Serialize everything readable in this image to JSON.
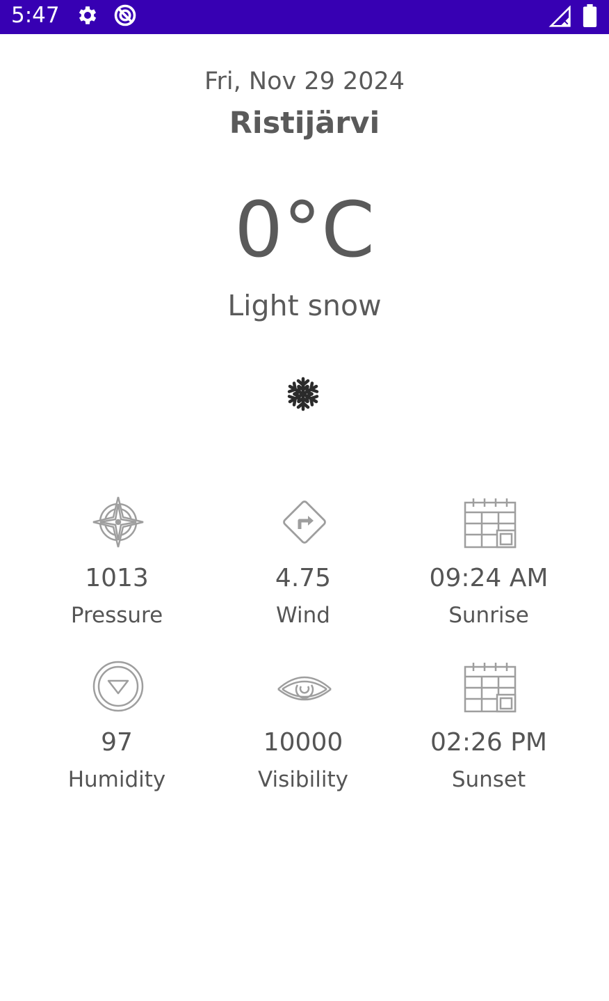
{
  "status_bar": {
    "time": "5:47",
    "background_color": "#3700b3",
    "icons": [
      "gear-icon",
      "vpn-icon",
      "signal-icon",
      "battery-icon"
    ]
  },
  "header": {
    "date": "Fri, Nov 29 2024",
    "city": "Ristijärvi"
  },
  "current": {
    "temperature": "0°C",
    "description": "Light snow",
    "icon": "snowflake-icon"
  },
  "details": [
    {
      "value": "1013",
      "label": "Pressure",
      "icon": "compass-icon"
    },
    {
      "value": "4.75",
      "label": "Wind",
      "icon": "direction-sign-icon"
    },
    {
      "value": "09:24 AM",
      "label": "Sunrise",
      "icon": "calendar-icon"
    },
    {
      "value": "97",
      "label": "Humidity",
      "icon": "humidity-icon"
    },
    {
      "value": "10000",
      "label": "Visibility",
      "icon": "eye-icon"
    },
    {
      "value": "02:26 PM",
      "label": "Sunset",
      "icon": "calendar-icon"
    }
  ],
  "colors": {
    "text": "#5a5a5a",
    "icon_stroke": "#9e9e9e"
  }
}
